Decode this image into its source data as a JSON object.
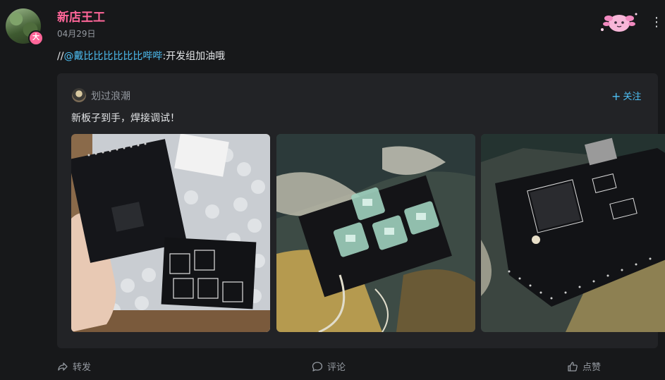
{
  "post": {
    "author": "新店王工",
    "avatar_badge": "大",
    "date": "04月29日",
    "text_prefix": "//",
    "mention": "@戴比比比比比比哔哔",
    "text_suffix": ":开发组加油哦"
  },
  "original": {
    "author": "划过浪潮",
    "follow_label": "关注",
    "text": "新板子到手，焊接调试！",
    "images": [
      {
        "icon": "pcb-in-bubble-wrap-photo"
      },
      {
        "icon": "pcb-with-key-switches-photo"
      },
      {
        "icon": "pcb-chip-closeup-photo"
      }
    ]
  },
  "actions": {
    "forward": "转发",
    "comment": "评论",
    "like": "点赞"
  },
  "colors": {
    "background": "#17181a",
    "card": "#222326",
    "username": "#ff6699",
    "link": "#4ec0f5",
    "muted": "#9499a0"
  }
}
